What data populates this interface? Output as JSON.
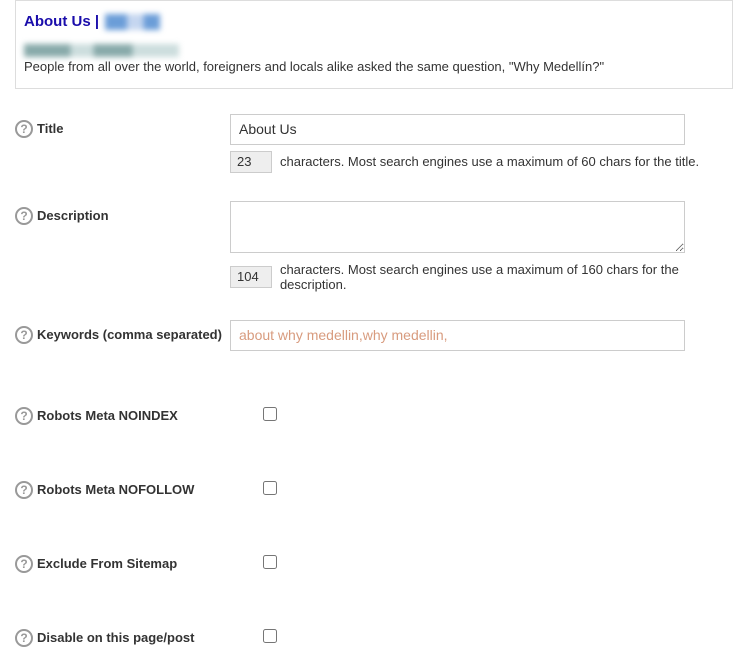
{
  "preview": {
    "title_prefix": "About Us |",
    "description": "People from all over the world, foreigners and locals alike asked the same question, \"Why Medellín?\""
  },
  "fields": {
    "title": {
      "label": "Title",
      "value": "About Us",
      "count": "23",
      "hint": "characters. Most search engines use a maximum of 60 chars for the title."
    },
    "description": {
      "label": "Description",
      "value": "",
      "count": "104",
      "hint": "characters. Most search engines use a maximum of 160 chars for the description."
    },
    "keywords": {
      "label": "Keywords (comma separated)",
      "placeholder": "about why medellin,why medellin,",
      "value": ""
    },
    "noindex": {
      "label": "Robots Meta NOINDEX"
    },
    "nofollow": {
      "label": "Robots Meta NOFOLLOW"
    },
    "exclude_sitemap": {
      "label": "Exclude From Sitemap"
    },
    "disable": {
      "label": "Disable on this page/post"
    }
  }
}
